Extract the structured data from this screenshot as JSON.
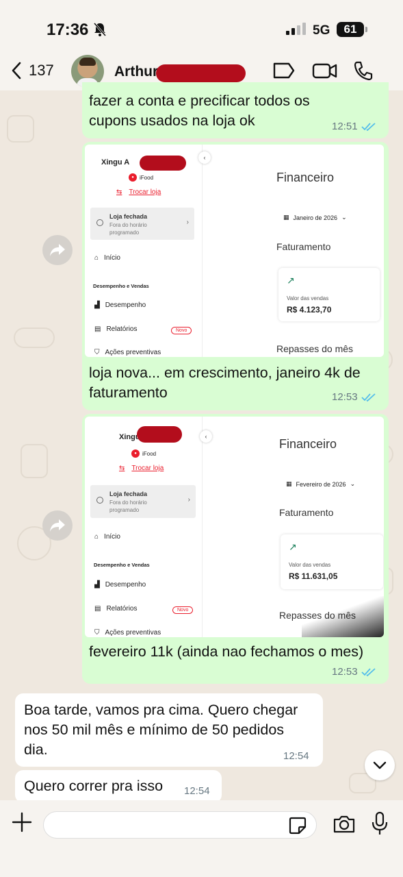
{
  "status_bar": {
    "time": "17:36",
    "network": "5G",
    "battery": "61"
  },
  "header": {
    "back_count": "137",
    "contact_name": "Arthur"
  },
  "messages": [
    {
      "type": "text",
      "direction": "outgoing",
      "text_lines": [
        "fazer a conta e precificar todos os",
        "cupons usados na loja ok"
      ],
      "time": "12:51"
    },
    {
      "type": "image",
      "direction": "outgoing",
      "caption_lines": [
        "loja nova... em crescimento, janeiro 4k de",
        "faturamento"
      ],
      "time": "12:53",
      "screenshot": {
        "store_name": "Xingu A",
        "brand": "iFood",
        "swap_label": "Trocar loja",
        "closed_title": "Loja fechada",
        "closed_sub_lines": [
          "Fora do horário",
          "programado"
        ],
        "nav_home": "Início",
        "section": "Desempenho e Vendas",
        "nav_perf": "Desempenho",
        "nav_reports": "Relatórios",
        "badge": "Novo",
        "nav_prev": "Ações preventivas",
        "title": "Financeiro",
        "month": "Janeiro de 2026",
        "faturamento": "Faturamento",
        "sales_label": "Valor das vendas",
        "sales_value": "R$ 4.123,70",
        "repasses": "Repasses do mês"
      }
    },
    {
      "type": "image",
      "direction": "outgoing",
      "caption_lines": [
        "fevereiro 11k (ainda nao fechamos o mes)"
      ],
      "time": "12:53",
      "screenshot": {
        "store_name": "Xingu",
        "brand": "iFood",
        "swap_label": "Trocar loja",
        "closed_title": "Loja fechada",
        "closed_sub_lines": [
          "Fora do horário",
          "programado"
        ],
        "nav_home": "Início",
        "section": "Desempenho e Vendas",
        "nav_perf": "Desempenho",
        "nav_reports": "Relatórios",
        "badge": "Novo",
        "nav_prev": "Ações preventivas",
        "title": "Financeiro",
        "month": "Fevereiro de 2026",
        "faturamento": "Faturamento",
        "sales_label": "Valor das vendas",
        "sales_value": "R$ 11.631,05",
        "repasses": "Repasses do mês"
      }
    },
    {
      "type": "text",
      "direction": "incoming",
      "text_lines": [
        "Boa tarde, vamos pra cima. Quero chegar",
        "nos 50 mil mês e mínimo de 50 pedidos",
        "dia."
      ],
      "time": "12:54"
    },
    {
      "type": "text",
      "direction": "incoming",
      "text_lines": [
        "Quero correr pra isso"
      ],
      "time": "12:54"
    }
  ],
  "input": {
    "placeholder": ""
  },
  "colors": {
    "outgoing_bubble": "#d9fdd3",
    "incoming_bubble": "#ffffff",
    "read_ticks": "#53bdeb",
    "ifood_red": "#ea1d2c",
    "redaction": "#b30d1c"
  },
  "icons": [
    "bell-off-icon",
    "back-chevron-icon",
    "label-tag-icon",
    "video-call-icon",
    "voice-call-icon",
    "forward-icon",
    "chevron-down-icon",
    "plus-icon",
    "sticker-icon",
    "camera-icon",
    "mic-icon",
    "double-check-icon"
  ]
}
